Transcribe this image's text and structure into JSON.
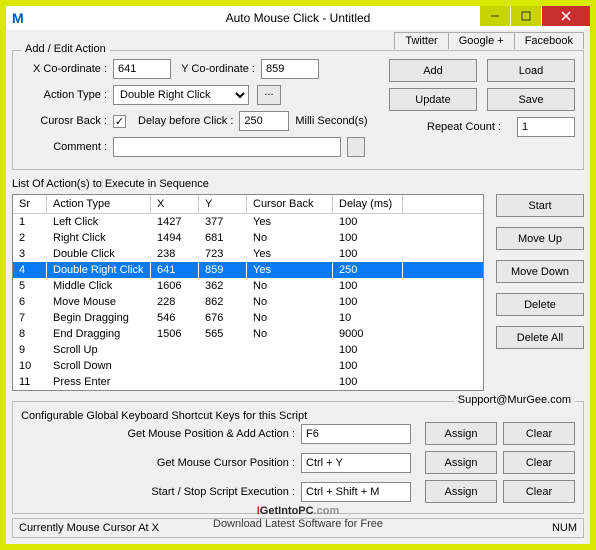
{
  "title": "Auto Mouse Click - Untitled",
  "top_tabs": [
    "Twitter",
    "Google +",
    "Facebook"
  ],
  "groupbox_add_edit": "Add / Edit Action",
  "labels": {
    "xcoord": "X Co-ordinate :",
    "ycoord": "Y Co-ordinate :",
    "action_type": "Action Type :",
    "cursor_back": "Curosr Back :",
    "delay_before_click": "Delay before Click :",
    "milli": "Milli Second(s)",
    "comment": "Comment :",
    "repeat_count": "Repeat Count :"
  },
  "values": {
    "xcoord": "641",
    "ycoord": "859",
    "action_type": "Double Right Click",
    "delay": "250",
    "comment": "",
    "repeat_count": "1",
    "cursor_back_checked": "✓"
  },
  "buttons": {
    "add": "Add",
    "load": "Load",
    "update": "Update",
    "save": "Save",
    "start": "Start",
    "move_up": "Move Up",
    "move_down": "Move Down",
    "delete": "Delete",
    "delete_all": "Delete All",
    "ellipsis": "...",
    "assign": "Assign",
    "clear": "Clear"
  },
  "list_header": "List Of Action(s) to Execute in Sequence",
  "table": {
    "headers": [
      "Sr",
      "Action Type",
      "X",
      "Y",
      "Cursor Back",
      "Delay (ms)"
    ],
    "rows": [
      {
        "sr": "1",
        "at": "Left Click",
        "x": "1427",
        "y": "377",
        "cb": "Yes",
        "dl": "100",
        "sel": false
      },
      {
        "sr": "2",
        "at": "Right Click",
        "x": "1494",
        "y": "681",
        "cb": "No",
        "dl": "100",
        "sel": false
      },
      {
        "sr": "3",
        "at": "Double Click",
        "x": "238",
        "y": "723",
        "cb": "Yes",
        "dl": "100",
        "sel": false
      },
      {
        "sr": "4",
        "at": "Double Right Click",
        "x": "641",
        "y": "859",
        "cb": "Yes",
        "dl": "250",
        "sel": true
      },
      {
        "sr": "5",
        "at": "Middle Click",
        "x": "1606",
        "y": "362",
        "cb": "No",
        "dl": "100",
        "sel": false
      },
      {
        "sr": "6",
        "at": "Move Mouse",
        "x": "228",
        "y": "862",
        "cb": "No",
        "dl": "100",
        "sel": false
      },
      {
        "sr": "7",
        "at": "Begin Dragging",
        "x": "546",
        "y": "676",
        "cb": "No",
        "dl": "10",
        "sel": false
      },
      {
        "sr": "8",
        "at": "End Dragging",
        "x": "1506",
        "y": "565",
        "cb": "No",
        "dl": "9000",
        "sel": false
      },
      {
        "sr": "9",
        "at": "Scroll Up",
        "x": "",
        "y": "",
        "cb": "",
        "dl": "100",
        "sel": false
      },
      {
        "sr": "10",
        "at": "Scroll Down",
        "x": "",
        "y": "",
        "cb": "",
        "dl": "100",
        "sel": false
      },
      {
        "sr": "11",
        "at": "Press Enter",
        "x": "",
        "y": "",
        "cb": "",
        "dl": "100",
        "sel": false
      }
    ]
  },
  "shortcuts": {
    "legend": "Configurable Global Keyboard Shortcut Keys for this Script",
    "support": "Support@MurGee.com",
    "rows": [
      {
        "label": "Get Mouse Position & Add Action :",
        "value": "F6"
      },
      {
        "label": "Get Mouse Cursor Position :",
        "value": "Ctrl + Y"
      },
      {
        "label": "Start / Stop Script Execution :",
        "value": "Ctrl + Shift + M"
      }
    ]
  },
  "statusbar": {
    "left": "Currently Mouse Cursor At X",
    "right": "NUM"
  },
  "watermark": {
    "i": "I",
    "rest": "GetIntoPC",
    "com": ".com",
    "line2": "Download Latest Software for Free"
  }
}
